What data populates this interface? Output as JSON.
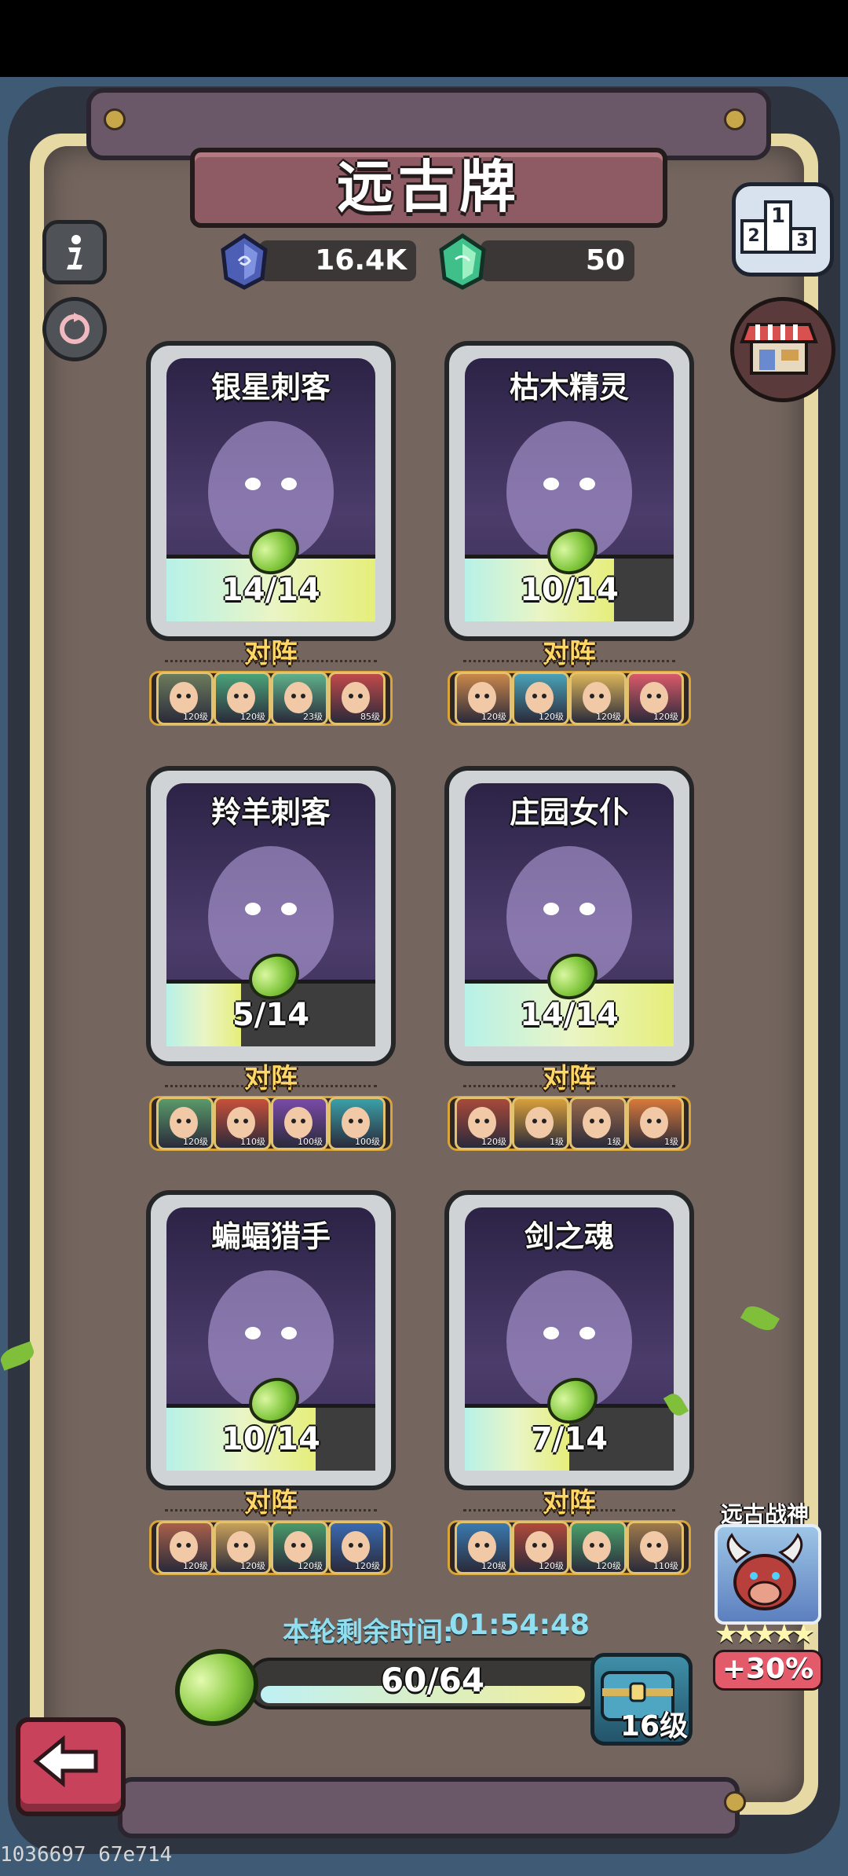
{
  "title": "远古牌",
  "currencies": [
    {
      "icon": "blue-crystal-icon",
      "value": "16.4K"
    },
    {
      "icon": "green-crystal-icon",
      "value": "50"
    }
  ],
  "side_buttons": {
    "info_icon": "info-icon",
    "refresh_icon": "refresh-icon",
    "ranking_icon": "podium-icon",
    "shop_icon": "shop-icon"
  },
  "cards": [
    {
      "name": "银星刺客",
      "progress": "14/14",
      "fill": 1.0,
      "vs_label": "对阵",
      "opponents": [
        {
          "level": "120级",
          "color": "#6c7c5c"
        },
        {
          "level": "120级",
          "color": "#4aa37a"
        },
        {
          "level": "23级",
          "color": "#5fb08a"
        },
        {
          "level": "85级",
          "color": "#c04a4a"
        }
      ]
    },
    {
      "name": "枯木精灵",
      "progress": "10/14",
      "fill": 0.7142,
      "vs_label": "对阵",
      "opponents": [
        {
          "level": "120级",
          "color": "#c9874a"
        },
        {
          "level": "120级",
          "color": "#4aa2b8"
        },
        {
          "level": "120级",
          "color": "#d9b45a"
        },
        {
          "level": "120级",
          "color": "#d95a6a"
        }
      ]
    },
    {
      "name": "羚羊刺客",
      "progress": "5/14",
      "fill": 0.3571,
      "vs_label": "对阵",
      "opponents": [
        {
          "level": "120级",
          "color": "#5a9a6a"
        },
        {
          "level": "110级",
          "color": "#c8503a"
        },
        {
          "level": "100级",
          "color": "#7a4aa8"
        },
        {
          "level": "100级",
          "color": "#3aa0a8"
        }
      ]
    },
    {
      "name": "庄园女仆",
      "progress": "14/14",
      "fill": 1.0,
      "vs_label": "对阵",
      "opponents": [
        {
          "level": "120级",
          "color": "#a84a3a"
        },
        {
          "level": "1级",
          "color": "#d9a03a"
        },
        {
          "level": "1级",
          "color": "#9a6a4a"
        },
        {
          "level": "1级",
          "color": "#d97a3a"
        }
      ]
    },
    {
      "name": "蝙蝠猎手",
      "progress": "10/14",
      "fill": 0.7142,
      "vs_label": "对阵",
      "opponents": [
        {
          "level": "120级",
          "color": "#a8604a"
        },
        {
          "level": "120级",
          "color": "#c8a05a"
        },
        {
          "level": "120级",
          "color": "#4a9a6a"
        },
        {
          "level": "120级",
          "color": "#3a6ab0"
        }
      ]
    },
    {
      "name": "剑之魂",
      "progress": "7/14",
      "fill": 0.5,
      "vs_label": "对阵",
      "opponents": [
        {
          "level": "120级",
          "color": "#3a7ab0"
        },
        {
          "level": "120级",
          "color": "#b04a3a"
        },
        {
          "level": "120级",
          "color": "#4aa06a"
        },
        {
          "level": "110级",
          "color": "#a07a4a"
        }
      ]
    }
  ],
  "timer": {
    "label": "本轮剩余时间:",
    "value": "01:54:48"
  },
  "total_progress": {
    "text": "60/64",
    "fill": 0.9375
  },
  "chest_level": "16级",
  "god": {
    "name": "远古战神",
    "stars": "★★★★★",
    "bonus": "+30%"
  },
  "back_icon": "back-arrow-icon",
  "debug_text": "1036697 67e714"
}
